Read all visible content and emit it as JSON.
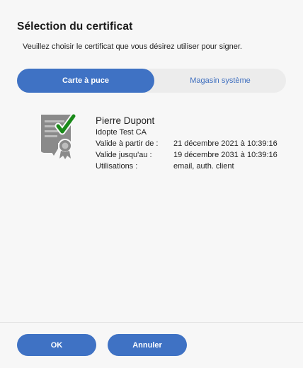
{
  "dialog": {
    "title": "Sélection du certificat",
    "subtitle": "Veuillez choisir le certificat que vous désirez utiliser pour signer."
  },
  "tabs": [
    {
      "label": "Carte à puce",
      "active": true
    },
    {
      "label": "Magasin système",
      "active": false
    }
  ],
  "certificate": {
    "icon": "certificate-icon",
    "name": "Pierre Dupont",
    "issuer": "Idopte Test CA",
    "rows": [
      {
        "label": "Valide à partir de :",
        "value": "21 décembre 2021 à 10:39:16"
      },
      {
        "label": "Valide jusqu'au :",
        "value": "19 décembre 2031 à 10:39:16"
      },
      {
        "label": "Utilisations :",
        "value": "email, auth. client"
      }
    ]
  },
  "buttons": {
    "ok": "OK",
    "cancel": "Annuler"
  },
  "colors": {
    "accent": "#3f72c4",
    "check": "#1a8a1a",
    "icon_gray": "#8a8a8a"
  }
}
